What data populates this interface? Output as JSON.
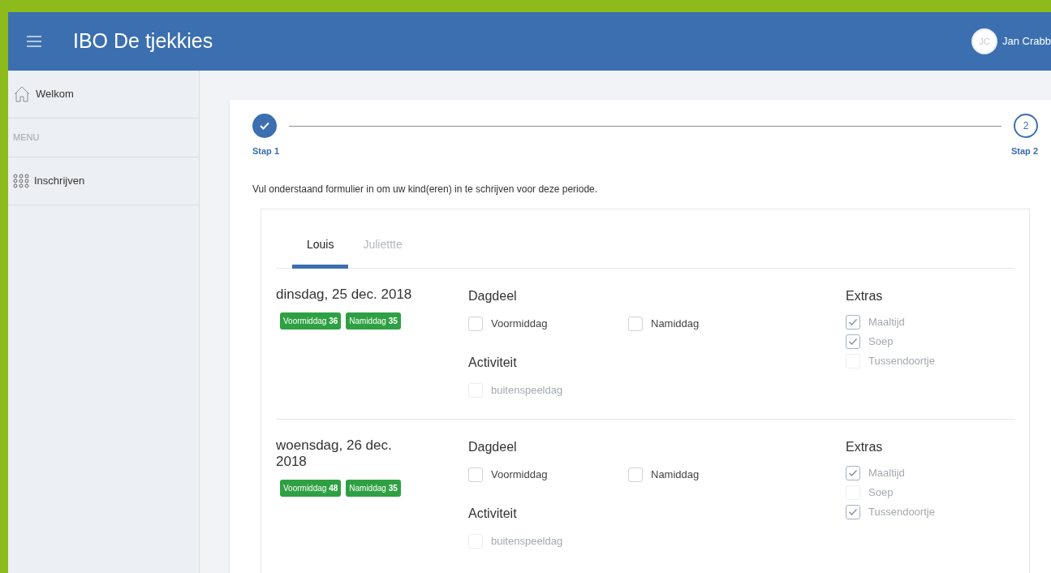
{
  "header": {
    "title": "IBO De tjekkies",
    "user": {
      "initials": "JC",
      "name": "Jan Crabb"
    }
  },
  "sidebar": {
    "items": [
      {
        "kind": "link",
        "label": "Welkom"
      },
      {
        "kind": "section",
        "label": "MENU"
      },
      {
        "kind": "link",
        "label": "Inschrijven"
      }
    ]
  },
  "stepper": {
    "steps": [
      {
        "label": "Stap 1",
        "done": true
      },
      {
        "label": "Stap 2",
        "done": false,
        "number": "2"
      }
    ]
  },
  "intro": "Vul onderstaand formulier in om uw kind(eren) in te schrijven voor deze periode.",
  "tabs": [
    {
      "label": "Louis",
      "selected": true
    },
    {
      "label": "Juliettte",
      "selected": false
    }
  ],
  "days": [
    {
      "date": "dinsdag, 25 dec. 2018",
      "badges": [
        "Voormiddag **36**",
        "Namiddag **35**"
      ],
      "dagdeel": {
        "title": "Dagdeel",
        "options": [
          {
            "label": "Voormiddag",
            "checked": false,
            "disabled": false
          },
          {
            "label": "Namiddag",
            "checked": false,
            "disabled": false
          }
        ]
      },
      "activiteit": {
        "title": "Activiteit",
        "options": [
          {
            "label": "buitenspeeldag",
            "checked": false,
            "disabled": true
          }
        ]
      },
      "extras": {
        "title": "Extras",
        "options": [
          {
            "label": "Maaltijd",
            "checked": true,
            "disabled": true
          },
          {
            "label": "Soep",
            "checked": true,
            "disabled": true
          },
          {
            "label": "Tussendoortje",
            "checked": false,
            "disabled": true
          }
        ]
      }
    },
    {
      "date": "woensdag, 26 dec. 2018",
      "badges": [
        "Voormiddag **48**",
        "Namiddag **35**"
      ],
      "dagdeel": {
        "title": "Dagdeel",
        "options": [
          {
            "label": "Voormiddag",
            "checked": false,
            "disabled": false
          },
          {
            "label": "Namiddag",
            "checked": false,
            "disabled": false
          }
        ]
      },
      "activiteit": {
        "title": "Activiteit",
        "options": [
          {
            "label": "buitenspeeldag",
            "checked": false,
            "disabled": true
          }
        ]
      },
      "extras": {
        "title": "Extras",
        "options": [
          {
            "label": "Maaltijd",
            "checked": true,
            "disabled": true
          },
          {
            "label": "Soep",
            "checked": false,
            "disabled": true
          },
          {
            "label": "Tussendoortje",
            "checked": true,
            "disabled": true
          }
        ]
      }
    }
  ]
}
